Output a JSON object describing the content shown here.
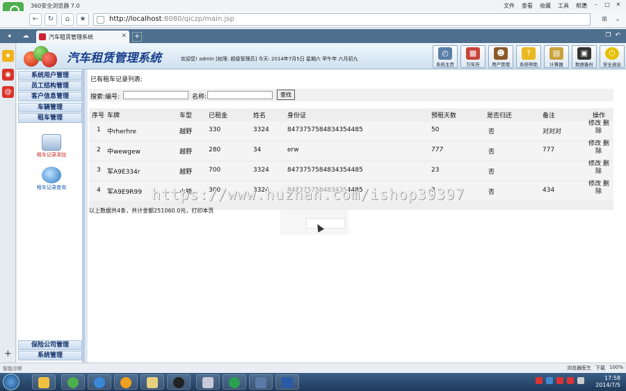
{
  "browser": {
    "window_title": "360安全浏览器 7.0",
    "menu": [
      "文件",
      "查看",
      "收藏",
      "工具",
      "帮助"
    ],
    "url_host": "http://localhost",
    "url_rest": ":8080/qiczp/main.jsp",
    "tab_label": "汽车租赁管理系统",
    "status_left": "智能诊断",
    "status_right": [
      "浏览器医生",
      "下载",
      "100%"
    ]
  },
  "header": {
    "title": "汽车租赁管理系统",
    "welcome": "欢迎您! admin [权限: 超级管理员] 今天: 2014年7月5日 星期六 甲午年 六月初九",
    "tools": [
      {
        "label": "系统主页",
        "icon": "clock-icon",
        "color": "#5a7fa8"
      },
      {
        "label": "万年历",
        "icon": "calendar-icon",
        "color": "#c8443a"
      },
      {
        "label": "用户管理",
        "icon": "user-icon",
        "color": "#8a5a2a"
      },
      {
        "label": "系统帮助",
        "icon": "help-icon",
        "color": "#e8b820"
      },
      {
        "label": "计算器",
        "icon": "calculator-icon",
        "color": "#c9a23a"
      },
      {
        "label": "数据备份",
        "icon": "disk-icon",
        "color": "#333333"
      },
      {
        "label": "安全退出",
        "icon": "power-icon",
        "color": "#e8c000"
      }
    ]
  },
  "sidebar": {
    "menus_top": [
      "系统用户管理",
      "员工结构管理",
      "客户信息管理",
      "车辆管理",
      "租车管理"
    ],
    "submenu": [
      {
        "label": "租车记录添加",
        "icon": "document-add-icon"
      },
      {
        "label": "租车记录查询",
        "icon": "globe-search-icon"
      }
    ],
    "menus_bottom": [
      "保险公司管理",
      "系统管理"
    ]
  },
  "main": {
    "list_title": "已有租车记录列表:",
    "search": {
      "label_no": "搜索:编号:",
      "label_name": "名称:",
      "no_value": "",
      "name_value": "",
      "button": "查找"
    },
    "columns": [
      "序号",
      "车牌",
      "车型",
      "已租金",
      "姓名",
      "身份证",
      "预租天数",
      "是否归还",
      "备注",
      "操作"
    ],
    "rows": [
      {
        "no": "1",
        "plate": "中rherhre",
        "type": "越野",
        "rent": "330",
        "name": "3324",
        "id": "8473757584834354485",
        "days": "50",
        "returned": "否",
        "note": "对对对"
      },
      {
        "no": "2",
        "plate": "中wewgew",
        "type": "越野",
        "rent": "280",
        "name": "34",
        "id": "erw",
        "days": "777",
        "returned": "否",
        "note": "777"
      },
      {
        "no": "3",
        "plate": "军A9E334r",
        "type": "越野",
        "rent": "700",
        "name": "3324",
        "id": "8473757584834354485",
        "days": "23",
        "returned": "否",
        "note": ""
      },
      {
        "no": "4",
        "plate": "军A9E9R99",
        "type": "小轿",
        "rent": "300",
        "name": "3324",
        "id": "8473757584834354485",
        "days": "3",
        "returned": "否",
        "note": "434"
      }
    ],
    "op_edit": "修改",
    "op_delete_1": "删",
    "op_delete_2": "除",
    "summary": "以上数据共4条，共计金额251060.0元，打印本页"
  },
  "watermark": "https://www.huzhan.com/ishop39397",
  "taskbar": {
    "time": "17:58",
    "date": "2014/7/5"
  }
}
